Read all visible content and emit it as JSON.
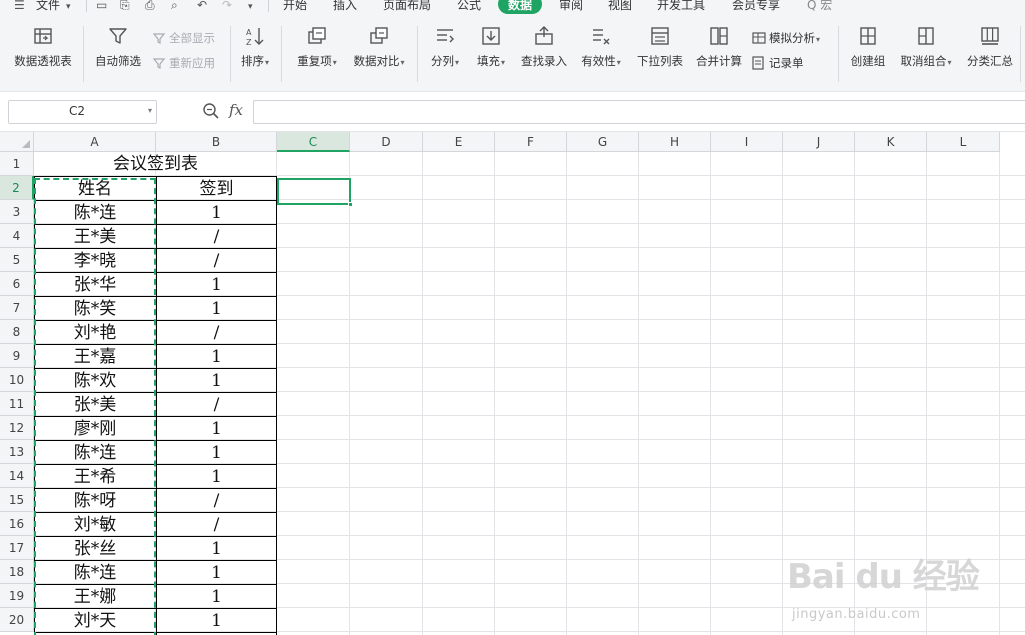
{
  "menu": {
    "file": "文件",
    "tabs": [
      "开始",
      "插入",
      "页面布局",
      "公式",
      "数据",
      "审阅",
      "视图",
      "开发工具",
      "会员专享"
    ],
    "active_tab": "数据",
    "search_text": "Q 宏",
    "accent": "#1fa463"
  },
  "ribbon": {
    "pivot": "数据透视表",
    "autofilter": "自动筛选",
    "show_all": "全部显示",
    "reapply": "重新应用",
    "sort": "排序",
    "duplicates": "重复项",
    "compare": "数据对比",
    "split": "分列",
    "fill": "填充",
    "lookup": "查找录入",
    "validation": "有效性",
    "dropdown_list": "下拉列表",
    "consolidate": "合并计算",
    "whatif": "模拟分析",
    "record": "记录单",
    "group": "创建组",
    "ungroup": "取消组合",
    "subtotal": "分类汇总"
  },
  "formula_bar": {
    "cell_ref": "C2",
    "fx": "fx",
    "value": ""
  },
  "sheet": {
    "columns": [
      "A",
      "B",
      "C",
      "D",
      "E",
      "F",
      "G",
      "H",
      "I",
      "J",
      "K",
      "L"
    ],
    "rows": [
      "1",
      "2",
      "3",
      "4",
      "5",
      "6",
      "7",
      "8",
      "9",
      "10",
      "11",
      "12",
      "13",
      "14",
      "15",
      "16",
      "17",
      "18",
      "19",
      "20"
    ],
    "selected_column": "C",
    "selected_row": "2",
    "title": "会议签到表",
    "header": [
      "姓名",
      "签到"
    ],
    "data": [
      [
        "陈*连",
        "1"
      ],
      [
        "王*美",
        "/"
      ],
      [
        "李*晓",
        "/"
      ],
      [
        "张*华",
        "1"
      ],
      [
        "陈*笑",
        "1"
      ],
      [
        "刘*艳",
        "/"
      ],
      [
        "王*嘉",
        "1"
      ],
      [
        "陈*欢",
        "1"
      ],
      [
        "张*美",
        "/"
      ],
      [
        "廖*刚",
        "1"
      ],
      [
        "陈*连",
        "1"
      ],
      [
        "王*希",
        "1"
      ],
      [
        "陈*呀",
        "/"
      ],
      [
        "刘*敏",
        "/"
      ],
      [
        "张*丝",
        "1"
      ],
      [
        "陈*连",
        "1"
      ],
      [
        "王*娜",
        "1"
      ],
      [
        "刘*天",
        "1"
      ]
    ]
  },
  "watermark": {
    "logo": "Bai du 经验",
    "url": "jingyan.baidu.com"
  }
}
